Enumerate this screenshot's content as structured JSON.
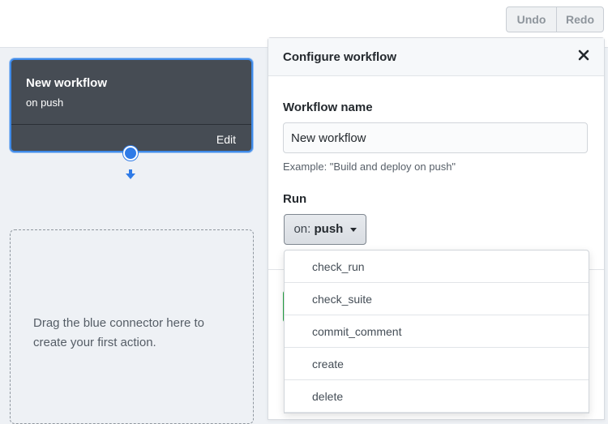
{
  "toolbar": {
    "undo_label": "Undo",
    "redo_label": "Redo"
  },
  "workflow_node": {
    "title": "New workflow",
    "trigger": "on push",
    "edit_label": "Edit"
  },
  "dropzone": {
    "message": "Drag the blue connector here to create your first action."
  },
  "panel": {
    "title": "Configure workflow",
    "name_label": "Workflow name",
    "name_value": "New workflow",
    "name_hint": "Example: \"Build and deploy on push\"",
    "run_label": "Run",
    "run_prefix": "on:",
    "run_value": "push"
  },
  "event_dropdown": {
    "options": [
      "check_run",
      "check_suite",
      "commit_comment",
      "create",
      "delete"
    ]
  },
  "colors": {
    "accent": "#2f7be7",
    "node_bg": "#464c54",
    "success": "#28a745"
  }
}
